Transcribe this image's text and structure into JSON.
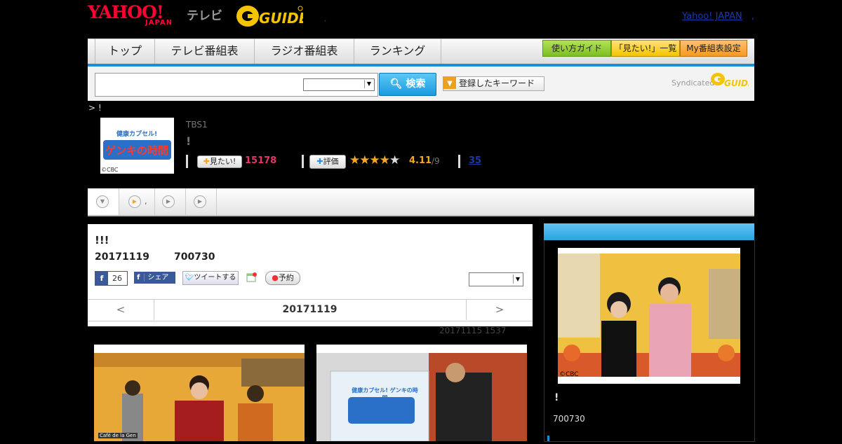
{
  "header": {
    "logo_yahoo": "YAHOO!",
    "logo_japan": "JAPAN",
    "logo_tv": "テレビ",
    "logo_gguide": "G-GUIDE",
    "yahoo_japan_link": "Yahoo! JAPAN",
    "top_dot": ",",
    "tiny_dot": ","
  },
  "nav": {
    "tabs": [
      "トップ",
      "テレビ番組表",
      "ラジオ番組表",
      "ランキング"
    ],
    "guide_buttons": [
      "使い方ガイド",
      "「見たい!」一覧",
      "My番組表設定"
    ]
  },
  "search": {
    "input_value": "",
    "select_value": "",
    "search_label": "検索",
    "keyword_label": "登録したキーワード",
    "syndicated": "Syndicated",
    "syndicated_logo": "G-GUIDE"
  },
  "breadcrumb": "> !",
  "program": {
    "thumb_text": "健康カプセル! ゲンキの時間",
    "thumb_copyright": "©CBC",
    "channel": "TBS1",
    "title": "!",
    "mitai_label": "見たい!",
    "mitai_count": "15178",
    "hyoka_label": "評価",
    "stars": "★★★★★",
    "rating": "4.11",
    "rating_of": "/9",
    "reviews": "35"
  },
  "sub_tabs": {
    "tab2_suffix": ","
  },
  "episode": {
    "title": "!!!",
    "date": "20171119",
    "time": "700730",
    "fb_count": "26",
    "fb_share": "シェア",
    "tweet": "ツイートする",
    "yoyaku": "予約",
    "select_value": "",
    "prev": "<",
    "nav_date": "20171119",
    "next": ">",
    "updated": "20171115  1537"
  },
  "photos": {
    "left_caption": "Café de la Gen",
    "right_screen_text": "健康カプセル! ゲンキの時間"
  },
  "sidebar": {
    "copyright": "©CBC",
    "title": "!",
    "time": "700730"
  },
  "colors": {
    "accent_blue": "#1a8fd6",
    "mitai_pink": "#e8336e",
    "star_orange": "#f5a623",
    "gguide_yellow": "#f5c400",
    "yahoo_red": "#ff0033"
  }
}
